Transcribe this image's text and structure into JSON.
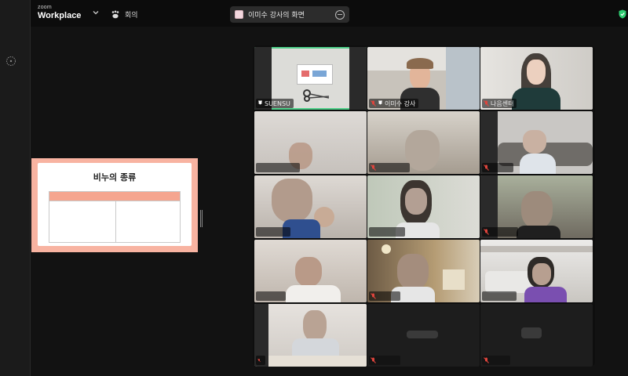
{
  "app": {
    "brand_small": "zoom",
    "brand_big": "Workplace"
  },
  "toolbar": {
    "meeting_label": "회의",
    "share_title": "이미수 강사의 화면"
  },
  "shared_content": {
    "title": "비누의 종류"
  },
  "participants": [
    {
      "name": "SUENSU",
      "pinned": true,
      "muted": false
    },
    {
      "name": "이미수 강사",
      "pinned": true,
      "muted": true
    },
    {
      "name": "나음센터",
      "pinned": false,
      "muted": true
    },
    {
      "name": "",
      "muted": false
    },
    {
      "name": "",
      "muted": true
    },
    {
      "name": "",
      "muted": true
    },
    {
      "name": "",
      "muted": false
    },
    {
      "name": "",
      "muted": false
    },
    {
      "name": "",
      "muted": true
    },
    {
      "name": "",
      "muted": false
    },
    {
      "name": "",
      "muted": true
    },
    {
      "name": "",
      "muted": false
    },
    {
      "name": "",
      "muted": true
    },
    {
      "name": "",
      "muted": true
    },
    {
      "name": "",
      "muted": true
    }
  ],
  "colors": {
    "active_border": "#4fd08a",
    "muted_red": "#e0453d",
    "slide_bg": "#f8b3a1"
  }
}
